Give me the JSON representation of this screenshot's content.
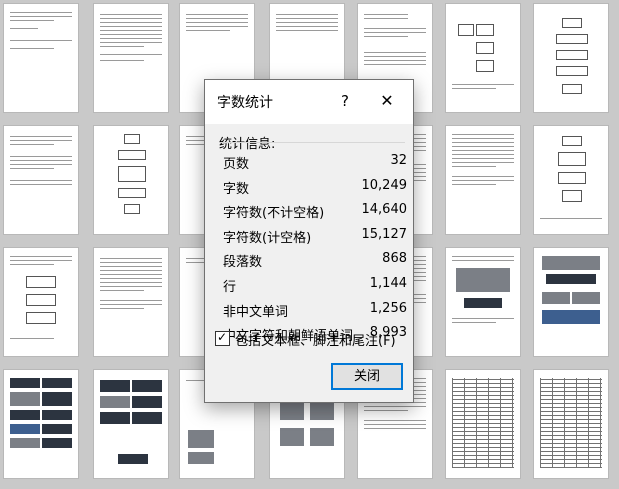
{
  "dialog": {
    "title": "字数统计",
    "help_label": "?",
    "close_glyph": "✕",
    "section_label": "统计信息:",
    "stats": [
      {
        "label": "页数",
        "value": "32"
      },
      {
        "label": "字数",
        "value": "10,249"
      },
      {
        "label": "字符数(不计空格)",
        "value": "14,640"
      },
      {
        "label": "字符数(计空格)",
        "value": "15,127"
      },
      {
        "label": "段落数",
        "value": "868"
      },
      {
        "label": "行",
        "value": "1,144"
      },
      {
        "label": "非中文单词",
        "value": "1,256"
      },
      {
        "label": "中文字符和朝鲜语单词",
        "value": "8,993"
      }
    ],
    "include_checkbox": {
      "label": "包括文本框、脚注和尾注(F)",
      "checked": true,
      "check_glyph": "✓"
    },
    "close_button_label": "关闭"
  }
}
